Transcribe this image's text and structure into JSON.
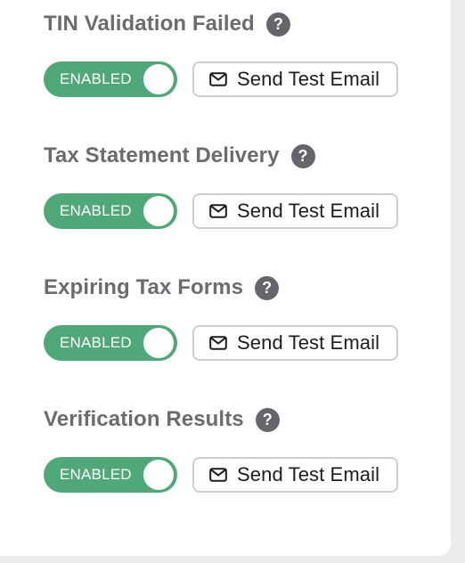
{
  "settings": [
    {
      "title": "TIN Validation Failed",
      "help_icon": "?",
      "toggle_label": "ENABLED",
      "enabled": true,
      "button_label": "Send Test Email",
      "button_icon": "envelope-icon"
    },
    {
      "title": "Tax Statement Delivery",
      "help_icon": "?",
      "toggle_label": "ENABLED",
      "enabled": true,
      "button_label": "Send Test Email",
      "button_icon": "envelope-icon"
    },
    {
      "title": "Expiring Tax Forms",
      "help_icon": "?",
      "toggle_label": "ENABLED",
      "enabled": true,
      "button_label": "Send Test Email",
      "button_icon": "envelope-icon"
    },
    {
      "title": "Verification Results",
      "help_icon": "?",
      "toggle_label": "ENABLED",
      "enabled": true,
      "button_label": "Send Test Email",
      "button_icon": "envelope-icon"
    }
  ],
  "colors": {
    "toggle_on": "#4fa878",
    "title_text": "#6b6b70",
    "help_icon_bg": "#65656b",
    "button_border": "#cfcfd3",
    "button_text": "#1d1d1f"
  }
}
